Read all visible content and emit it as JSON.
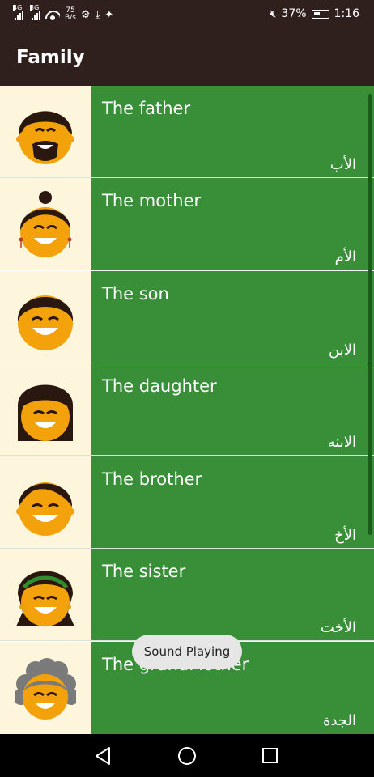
{
  "status_bar": {
    "signal_1_label": "4G",
    "signal_2_label": "3G",
    "net_speed_value": "75",
    "net_speed_unit": "B/s",
    "battery_percent": "37%",
    "time": "1:16"
  },
  "app_bar": {
    "title": "Family"
  },
  "family": [
    {
      "english": "The father",
      "arabic": "الأب",
      "face": "father"
    },
    {
      "english": "The mother",
      "arabic": "الأم",
      "face": "mother"
    },
    {
      "english": "The son",
      "arabic": "الابن",
      "face": "son"
    },
    {
      "english": "The daughter",
      "arabic": "الابنه",
      "face": "daughter"
    },
    {
      "english": "The brother",
      "arabic": "الأخ",
      "face": "brother"
    },
    {
      "english": "The sister",
      "arabic": "الأخت",
      "face": "sister"
    },
    {
      "english": "The grandMother",
      "arabic": "الجدة",
      "face": "grandmother"
    }
  ],
  "toast": {
    "message": "Sound Playing"
  },
  "colors": {
    "app_bar": "#2f1f1d",
    "list_item_bg": "#398f38",
    "face_bg": "#fdf5dc",
    "skin": "#f4a20c",
    "hair": "#2a1710"
  }
}
